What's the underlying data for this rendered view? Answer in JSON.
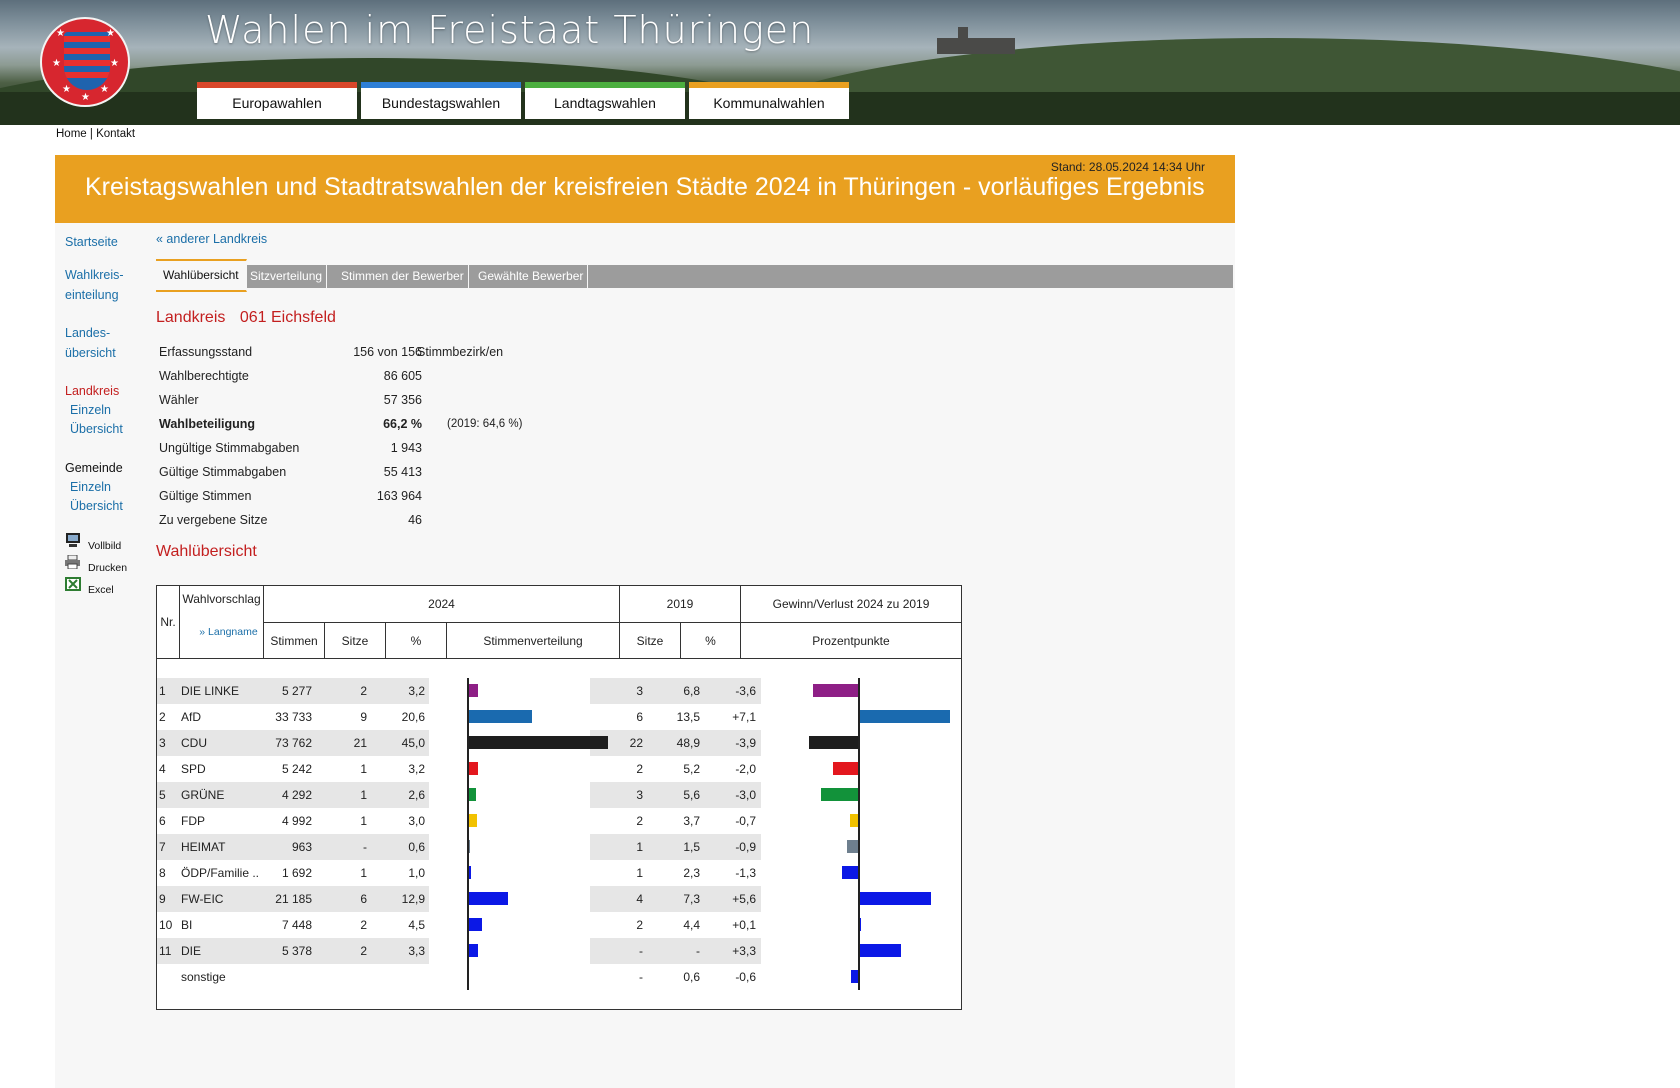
{
  "header": {
    "site_title": "Wahlen im Freistaat Thüringen",
    "nav": [
      {
        "label": "Europawahlen",
        "color": "#d9472b"
      },
      {
        "label": "Bundestagswahlen",
        "color": "#2e7fd6"
      },
      {
        "label": "Landtagswahlen",
        "color": "#4caf3f"
      },
      {
        "label": "Kommunalwahlen",
        "color": "#e9a020"
      }
    ]
  },
  "topnav": {
    "home": "Home",
    "sep": "|",
    "kontakt": "Kontakt"
  },
  "banner": {
    "stand": "Stand: 28.05.2024  14:34 Uhr",
    "title": "Kreistagswahlen und Stadtratswahlen der kreisfreien Städte 2024 in Thüringen - vorläufiges Ergebnis"
  },
  "sidebar": {
    "startseite": "Startseite",
    "wahlkreis_1": "Wahlkreis-",
    "wahlkreis_2": "einteilung",
    "landes_1": "Landes-",
    "landes_2": "übersicht",
    "landkreis": "Landkreis",
    "landkreis_einzeln": "Einzeln",
    "landkreis_uebersicht": "Übersicht",
    "gemeinde": "Gemeinde",
    "gemeinde_einzeln": "Einzeln",
    "gemeinde_uebersicht": "Übersicht",
    "tools": {
      "vollbild": "Vollbild",
      "drucken": "Drucken",
      "excel": "Excel"
    }
  },
  "main": {
    "back_link": "« anderer Landkreis",
    "tabs": [
      "Wahlübersicht",
      "Sitzverteilung",
      "Stimmen der Bewerber",
      "Gewählte Bewerber"
    ],
    "active_tab": "Wahlübersicht",
    "district_type": "Landkreis",
    "district_name": "061 Eichsfeld",
    "stats": {
      "erfassung": {
        "label": "Erfassungsstand",
        "value": "156 von 156",
        "extra": "Stimmbezirk/en"
      },
      "wahlberechtigte": {
        "label": "Wahlberechtigte",
        "value": "86 605"
      },
      "waehler": {
        "label": "Wähler",
        "value": "57 356"
      },
      "beteiligung": {
        "label": "Wahlbeteiligung",
        "value": "66,2  %",
        "extra": "(2019: 64,6  %)"
      },
      "ungueltig": {
        "label": "Ungültige Stimmabgaben",
        "value": "1 943"
      },
      "gueltig_abgaben": {
        "label": "Gültige Stimmabgaben",
        "value": "55 413"
      },
      "gueltig_stimmen": {
        "label": "Gültige Stimmen",
        "value": "163 964"
      },
      "sitze": {
        "label": "Zu vergebene Sitze",
        "value": "46"
      }
    },
    "section_title": "Wahlübersicht"
  },
  "table": {
    "headers": {
      "nr": "Nr.",
      "wahlvorschlag": "Wahlvorschlag",
      "langname": "» Langname",
      "y2024": "2024",
      "y2019": "2019",
      "gewinn": "Gewinn/Verlust 2024 zu 2019",
      "stimmen": "Stimmen",
      "sitze": "Sitze",
      "pct": "%",
      "stimmenverteilung": "Stimmenverteilung",
      "sitze19": "Sitze",
      "pct19": "%",
      "prozentpunkte": "Prozentpunkte"
    },
    "rows": [
      {
        "nr": "1",
        "name": "DIE LINKE",
        "stimmen": "5 277",
        "sitze": "2",
        "pct": "3,2",
        "sitze19": "3",
        "pct19": "6,8",
        "diff": "-3,6",
        "pct_val": 3.2,
        "diff_val": -3.6,
        "color": "#8e1f86"
      },
      {
        "nr": "2",
        "name": "AfD",
        "stimmen": "33 733",
        "sitze": "9",
        "pct": "20,6",
        "sitze19": "6",
        "pct19": "13,5",
        "diff": "+7,1",
        "pct_val": 20.6,
        "diff_val": 7.1,
        "color": "#1a6aaf"
      },
      {
        "nr": "3",
        "name": "CDU",
        "stimmen": "73 762",
        "sitze": "21",
        "pct": "45,0",
        "sitze19": "22",
        "pct19": "48,9",
        "diff": "-3,9",
        "pct_val": 45.0,
        "diff_val": -3.9,
        "color": "#1e1e1e"
      },
      {
        "nr": "4",
        "name": "SPD",
        "stimmen": "5 242",
        "sitze": "1",
        "pct": "3,2",
        "sitze19": "2",
        "pct19": "5,2",
        "diff": "-2,0",
        "pct_val": 3.2,
        "diff_val": -2.0,
        "color": "#e3171e"
      },
      {
        "nr": "5",
        "name": "GRÜNE",
        "stimmen": "4 292",
        "sitze": "1",
        "pct": "2,6",
        "sitze19": "3",
        "pct19": "5,6",
        "diff": "-3,0",
        "pct_val": 2.6,
        "diff_val": -3.0,
        "color": "#12923a"
      },
      {
        "nr": "6",
        "name": "FDP",
        "stimmen": "4 992",
        "sitze": "1",
        "pct": "3,0",
        "sitze19": "2",
        "pct19": "3,7",
        "diff": "-0,7",
        "pct_val": 3.0,
        "diff_val": -0.7,
        "color": "#f2c200"
      },
      {
        "nr": "7",
        "name": "HEIMAT",
        "stimmen": "963",
        "sitze": "-",
        "pct": "0,6",
        "sitze19": "1",
        "pct19": "1,5",
        "diff": "-0,9",
        "pct_val": 0.6,
        "diff_val": -0.9,
        "color": "#6e7f8e"
      },
      {
        "nr": "8",
        "name": "ÖDP/Familie ..",
        "stimmen": "1 692",
        "sitze": "1",
        "pct": "1,0",
        "sitze19": "1",
        "pct19": "2,3",
        "diff": "-1,3",
        "pct_val": 1.0,
        "diff_val": -1.3,
        "color": "#0b18e6"
      },
      {
        "nr": "9",
        "name": "FW-EIC",
        "stimmen": "21 185",
        "sitze": "6",
        "pct": "12,9",
        "sitze19": "4",
        "pct19": "7,3",
        "diff": "+5,6",
        "pct_val": 12.9,
        "diff_val": 5.6,
        "color": "#0b18e6"
      },
      {
        "nr": "10",
        "name": "BI",
        "stimmen": "7 448",
        "sitze": "2",
        "pct": "4,5",
        "sitze19": "2",
        "pct19": "4,4",
        "diff": "+0,1",
        "pct_val": 4.5,
        "diff_val": 0.1,
        "color": "#0b18e6"
      },
      {
        "nr": "11",
        "name": "DIE",
        "stimmen": "5 378",
        "sitze": "2",
        "pct": "3,3",
        "sitze19": "-",
        "pct19": "-",
        "diff": "+3,3",
        "pct_val": 3.3,
        "diff_val": 3.3,
        "color": "#0b18e6"
      },
      {
        "nr": "",
        "name": "sonstige",
        "stimmen": "",
        "sitze": "",
        "pct": "",
        "sitze19": "-",
        "pct19": "0,6",
        "diff": "-0,6",
        "pct_val": 0,
        "diff_val": -0.6,
        "color": "#0b18e6"
      }
    ]
  }
}
